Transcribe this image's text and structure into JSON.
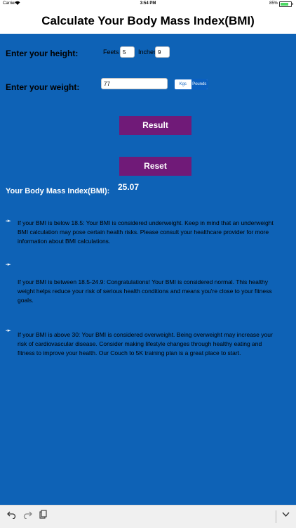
{
  "status": {
    "carrier": "Carrier",
    "time": "3:54 PM",
    "battery": "85%"
  },
  "header": {
    "title": "Calculate Your Body Mass Index(BMI)"
  },
  "height": {
    "label": "Enter your height:",
    "feet_label": "Feets",
    "feet_value": "5",
    "inches_label": "Inches",
    "inches_value": "9"
  },
  "weight": {
    "label": "Enter your weight:",
    "value": "77",
    "units": [
      "Kgs",
      "Pounds"
    ],
    "selected_unit": "Pounds"
  },
  "buttons": {
    "result": "Result",
    "reset": "Reset"
  },
  "bmi": {
    "label": "Your Body Mass Index(BMI):",
    "value": "25.07"
  },
  "info": {
    "arrow": "➛",
    "under": "If your BMI is below 18.5: Your BMI is considered underweight. Keep in mind that an underweight BMI calculation may pose certain health risks. Please consult your healthcare provider for more information about BMI calculations.",
    "normal": "If your BMI is between 18.5-24.9: Congratulations! Your BMI is considered normal. This healthy weight helps reduce your risk of serious health conditions and means you're close to your fitness goals.",
    "over": "If your BMI is above 30: Your BMI is considered overweight. Being overweight may increase your risk of cardiovascular disease. Consider making lifestyle changes through healthy eating and fitness to improve your health. Our Couch to 5K training plan is a great place to start."
  },
  "colors": {
    "background": "#0e62b6",
    "button": "#701a78"
  },
  "icons": [
    "undo-icon",
    "redo-icon",
    "paste-icon",
    "chevron-down-icon"
  ]
}
